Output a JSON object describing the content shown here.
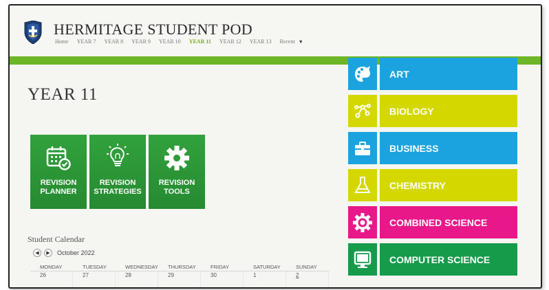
{
  "site": {
    "title": "HERMITAGE STUDENT POD"
  },
  "nav": {
    "items": [
      "Home",
      "YEAR 7",
      "YEAR 8",
      "YEAR 9",
      "YEAR 10",
      "YEAR 11",
      "YEAR 12",
      "YEAR 13",
      "Recent"
    ],
    "active": "YEAR 11"
  },
  "page": {
    "title": "YEAR 11"
  },
  "tiles": [
    {
      "label_1": "REVISION",
      "label_2": "PLANNER",
      "icon": "calendar-check-icon"
    },
    {
      "label_1": "REVISION",
      "label_2": "STRATEGIES",
      "icon": "lightbulb-icon"
    },
    {
      "label_1": "REVISION",
      "label_2": "TOOLS",
      "icon": "gear-icon"
    }
  ],
  "calendar": {
    "title": "Student Calendar",
    "month": "October 2022",
    "days": [
      "MONDAY",
      "TUESDAY",
      "WEDNESDAY",
      "THURSDAY",
      "FRIDAY",
      "SATURDAY",
      "SUNDAY"
    ],
    "first_row": [
      "26",
      "27",
      "28",
      "29",
      "30",
      "1",
      "2"
    ]
  },
  "subjects": [
    {
      "name": "ART",
      "color": "#1aa3de",
      "icon": "palette-icon"
    },
    {
      "name": "BIOLOGY",
      "color": "#d4d800",
      "icon": "molecule-icon"
    },
    {
      "name": "BUSINESS",
      "color": "#1aa3de",
      "icon": "briefcase-icon"
    },
    {
      "name": "CHEMISTRY",
      "color": "#d4d800",
      "icon": "flask-icon"
    },
    {
      "name": "COMBINED SCIENCE",
      "color": "#e8178a",
      "icon": "atom-gear-icon"
    },
    {
      "name": "COMPUTER SCIENCE",
      "color": "#169b4a",
      "icon": "monitor-icon"
    }
  ],
  "colors": {
    "accent_green": "#6fb52a",
    "tile_green": "#2e9a3a",
    "nav_active": "#7aab1e"
  }
}
